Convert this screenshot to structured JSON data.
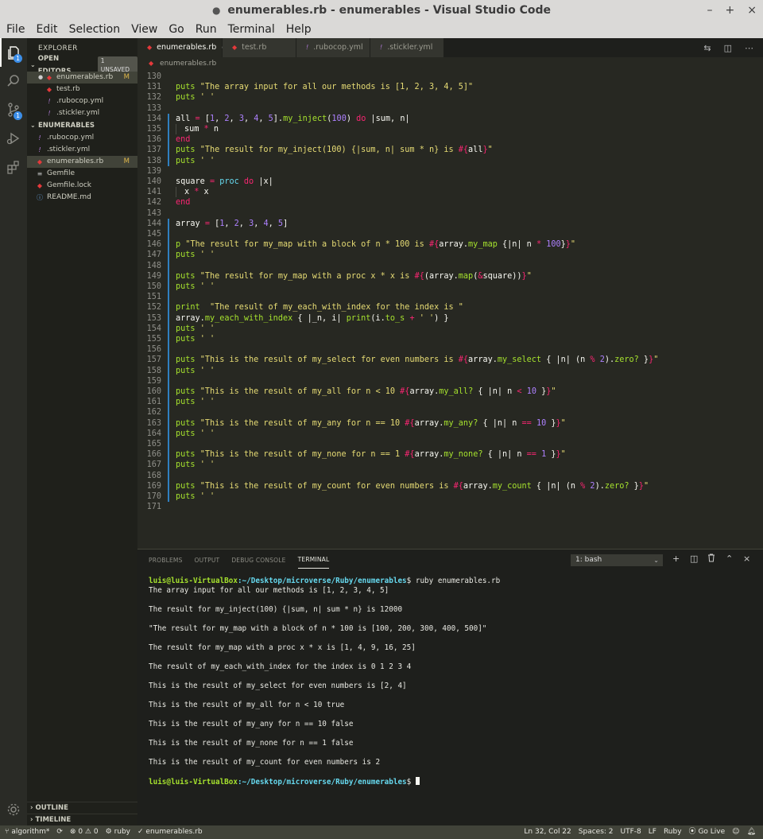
{
  "window": {
    "title": "enumerables.rb - enumerables - Visual Studio Code",
    "modified_dot": "●",
    "minimize": "–",
    "maximize": "+",
    "close": "×"
  },
  "menu": [
    "File",
    "Edit",
    "Selection",
    "View",
    "Go",
    "Run",
    "Terminal",
    "Help"
  ],
  "activity": {
    "explorer_badge": "1",
    "scm_badge": "1"
  },
  "sidebar": {
    "title": "EXPLORER",
    "open_editors_label": "OPEN EDITORS",
    "unsaved_badge": "1 UNSAVED",
    "open_editors": [
      {
        "name": "enumerables.rb",
        "icon": "ruby-icon",
        "flag": "M",
        "selected": true
      },
      {
        "name": "test.rb",
        "icon": "ruby-icon",
        "flag": ""
      },
      {
        "name": ".rubocop.yml",
        "icon": "yml-icon",
        "flag": ""
      },
      {
        "name": ".stickler.yml",
        "icon": "yml-icon",
        "flag": ""
      }
    ],
    "folder_label": "ENUMERABLES",
    "files": [
      {
        "name": ".rubocop.yml",
        "icon": "yml-icon",
        "flag": ""
      },
      {
        "name": ".stickler.yml",
        "icon": "yml-icon",
        "flag": ""
      },
      {
        "name": "enumerables.rb",
        "icon": "ruby-icon",
        "flag": "M",
        "selected": true
      },
      {
        "name": "Gemfile",
        "icon": "lines-icon",
        "flag": ""
      },
      {
        "name": "Gemfile.lock",
        "icon": "ruby-icon",
        "flag": ""
      },
      {
        "name": "README.md",
        "icon": "info-icon",
        "flag": ""
      }
    ],
    "outline_label": "OUTLINE",
    "timeline_label": "TIMELINE"
  },
  "tabs": [
    {
      "name": "enumerables.rb",
      "icon": "ruby-icon",
      "active": true,
      "dirty": true
    },
    {
      "name": "test.rb",
      "icon": "ruby-icon",
      "active": false
    },
    {
      "name": ".rubocop.yml",
      "icon": "yml-icon",
      "active": false
    },
    {
      "name": ".stickler.yml",
      "icon": "yml-icon",
      "active": false
    }
  ],
  "breadcrumb": "enumerables.rb",
  "editor": {
    "lines": [
      {
        "n": "130",
        "g": 0,
        "t": []
      },
      {
        "n": "131",
        "g": 0,
        "t": [
          [
            "fn",
            "puts"
          ],
          [
            "txt",
            " "
          ],
          [
            "str",
            "\"The array input for all our methods is [1, 2, 3, 4, 5]\""
          ]
        ]
      },
      {
        "n": "132",
        "g": 0,
        "t": [
          [
            "fn",
            "puts"
          ],
          [
            "txt",
            " "
          ],
          [
            "str",
            "' '"
          ]
        ]
      },
      {
        "n": "133",
        "g": 0,
        "t": []
      },
      {
        "n": "134",
        "g": 1,
        "t": [
          [
            "txt",
            "all "
          ],
          [
            "kw",
            "="
          ],
          [
            "txt",
            " ["
          ],
          [
            "num",
            "1"
          ],
          [
            "txt",
            ", "
          ],
          [
            "num",
            "2"
          ],
          [
            "txt",
            ", "
          ],
          [
            "num",
            "3"
          ],
          [
            "txt",
            ", "
          ],
          [
            "num",
            "4"
          ],
          [
            "txt",
            ", "
          ],
          [
            "num",
            "5"
          ],
          [
            "txt",
            "]."
          ],
          [
            "fn",
            "my_inject"
          ],
          [
            "txt",
            "("
          ],
          [
            "num",
            "100"
          ],
          [
            "txt",
            ") "
          ],
          [
            "kw",
            "do"
          ],
          [
            "txt",
            " |sum, n|"
          ]
        ]
      },
      {
        "n": "135",
        "g": 1,
        "i": 1,
        "t": [
          [
            "txt",
            "sum "
          ],
          [
            "kw",
            "*"
          ],
          [
            "txt",
            " n"
          ]
        ]
      },
      {
        "n": "136",
        "g": 1,
        "t": [
          [
            "kw",
            "end"
          ]
        ]
      },
      {
        "n": "137",
        "g": 1,
        "t": [
          [
            "fn",
            "puts"
          ],
          [
            "txt",
            " "
          ],
          [
            "str",
            "\"The result for my_inject(100) {|sum, n| sum * n} is "
          ],
          [
            "ip",
            "#{"
          ],
          [
            "txt",
            "all"
          ],
          [
            "ip",
            "}"
          ],
          [
            "str",
            "\""
          ]
        ]
      },
      {
        "n": "138",
        "g": 1,
        "t": [
          [
            "fn",
            "puts"
          ],
          [
            "txt",
            " "
          ],
          [
            "str",
            "' '"
          ]
        ]
      },
      {
        "n": "139",
        "g": 0,
        "t": []
      },
      {
        "n": "140",
        "g": 0,
        "t": [
          [
            "txt",
            "square "
          ],
          [
            "kw",
            "="
          ],
          [
            "txt",
            " "
          ],
          [
            "c",
            "proc"
          ],
          [
            "txt",
            " "
          ],
          [
            "kw",
            "do"
          ],
          [
            "txt",
            " |x|"
          ]
        ]
      },
      {
        "n": "141",
        "g": 0,
        "i": 1,
        "t": [
          [
            "txt",
            "x "
          ],
          [
            "kw",
            "*"
          ],
          [
            "txt",
            " x"
          ]
        ]
      },
      {
        "n": "142",
        "g": 0,
        "t": [
          [
            "kw",
            "end"
          ]
        ]
      },
      {
        "n": "143",
        "g": 0,
        "t": []
      },
      {
        "n": "144",
        "g": 1,
        "t": [
          [
            "txt",
            "array "
          ],
          [
            "kw",
            "="
          ],
          [
            "txt",
            " ["
          ],
          [
            "num",
            "1"
          ],
          [
            "txt",
            ", "
          ],
          [
            "num",
            "2"
          ],
          [
            "txt",
            ", "
          ],
          [
            "num",
            "3"
          ],
          [
            "txt",
            ", "
          ],
          [
            "num",
            "4"
          ],
          [
            "txt",
            ", "
          ],
          [
            "num",
            "5"
          ],
          [
            "txt",
            "]"
          ]
        ]
      },
      {
        "n": "145",
        "g": 1,
        "t": []
      },
      {
        "n": "146",
        "g": 1,
        "t": [
          [
            "fn",
            "p"
          ],
          [
            "txt",
            " "
          ],
          [
            "str",
            "\"The result for my_map with a block of n * 100 is "
          ],
          [
            "ip",
            "#{"
          ],
          [
            "txt",
            "array."
          ],
          [
            "fn",
            "my_map"
          ],
          [
            "txt",
            " {|n| n "
          ],
          [
            "kw",
            "*"
          ],
          [
            "txt",
            " "
          ],
          [
            "num",
            "100"
          ],
          [
            "txt",
            "}"
          ],
          [
            "ip",
            "}"
          ],
          [
            "str",
            "\""
          ]
        ]
      },
      {
        "n": "147",
        "g": 1,
        "t": [
          [
            "fn",
            "puts"
          ],
          [
            "txt",
            " "
          ],
          [
            "str",
            "' '"
          ]
        ]
      },
      {
        "n": "148",
        "g": 1,
        "t": []
      },
      {
        "n": "149",
        "g": 1,
        "t": [
          [
            "fn",
            "puts"
          ],
          [
            "txt",
            " "
          ],
          [
            "str",
            "\"The result for my_map with a proc x * x is "
          ],
          [
            "ip",
            "#{"
          ],
          [
            "txt",
            "(array."
          ],
          [
            "fn",
            "map"
          ],
          [
            "txt",
            "("
          ],
          [
            "kw",
            "&"
          ],
          [
            "txt",
            "square))"
          ],
          [
            "ip",
            "}"
          ],
          [
            "str",
            "\""
          ]
        ]
      },
      {
        "n": "150",
        "g": 1,
        "t": [
          [
            "fn",
            "puts"
          ],
          [
            "txt",
            " "
          ],
          [
            "str",
            "' '"
          ]
        ]
      },
      {
        "n": "151",
        "g": 1,
        "t": []
      },
      {
        "n": "152",
        "g": 1,
        "t": [
          [
            "fn",
            "print"
          ],
          [
            "txt",
            "  "
          ],
          [
            "str",
            "\"The result of my_each_with_index for the index is \""
          ]
        ]
      },
      {
        "n": "153",
        "g": 1,
        "t": [
          [
            "txt",
            "array."
          ],
          [
            "fn",
            "my_each_with_index"
          ],
          [
            "txt",
            " { |_n, i| "
          ],
          [
            "fn",
            "print"
          ],
          [
            "txt",
            "(i."
          ],
          [
            "fn",
            "to_s"
          ],
          [
            "txt",
            " "
          ],
          [
            "kw",
            "+"
          ],
          [
            "txt",
            " "
          ],
          [
            "str",
            "' '"
          ],
          [
            "txt",
            ") }"
          ]
        ]
      },
      {
        "n": "154",
        "g": 1,
        "t": [
          [
            "fn",
            "puts"
          ],
          [
            "txt",
            " "
          ],
          [
            "str",
            "' '"
          ]
        ]
      },
      {
        "n": "155",
        "g": 1,
        "t": [
          [
            "fn",
            "puts"
          ],
          [
            "txt",
            " "
          ],
          [
            "str",
            "' '"
          ]
        ]
      },
      {
        "n": "156",
        "g": 1,
        "t": []
      },
      {
        "n": "157",
        "g": 1,
        "t": [
          [
            "fn",
            "puts"
          ],
          [
            "txt",
            " "
          ],
          [
            "str",
            "\"This is the result of my_select for even numbers is "
          ],
          [
            "ip",
            "#{"
          ],
          [
            "txt",
            "array."
          ],
          [
            "fn",
            "my_select"
          ],
          [
            "txt",
            " { |n| (n "
          ],
          [
            "kw",
            "%"
          ],
          [
            "txt",
            " "
          ],
          [
            "num",
            "2"
          ],
          [
            "txt",
            ")."
          ],
          [
            "fn",
            "zero?"
          ],
          [
            "txt",
            " }"
          ],
          [
            "ip",
            "}"
          ],
          [
            "str",
            "\""
          ]
        ]
      },
      {
        "n": "158",
        "g": 1,
        "t": [
          [
            "fn",
            "puts"
          ],
          [
            "txt",
            " "
          ],
          [
            "str",
            "' '"
          ]
        ]
      },
      {
        "n": "159",
        "g": 1,
        "t": []
      },
      {
        "n": "160",
        "g": 1,
        "t": [
          [
            "fn",
            "puts"
          ],
          [
            "txt",
            " "
          ],
          [
            "str",
            "\"This is the result of my_all for n < 10 "
          ],
          [
            "ip",
            "#{"
          ],
          [
            "txt",
            "array."
          ],
          [
            "fn",
            "my_all?"
          ],
          [
            "txt",
            " { |n| n "
          ],
          [
            "kw",
            "<"
          ],
          [
            "txt",
            " "
          ],
          [
            "num",
            "10"
          ],
          [
            "txt",
            " }"
          ],
          [
            "ip",
            "}"
          ],
          [
            "str",
            "\""
          ]
        ]
      },
      {
        "n": "161",
        "g": 1,
        "t": [
          [
            "fn",
            "puts"
          ],
          [
            "txt",
            " "
          ],
          [
            "str",
            "' '"
          ]
        ]
      },
      {
        "n": "162",
        "g": 1,
        "t": []
      },
      {
        "n": "163",
        "g": 1,
        "t": [
          [
            "fn",
            "puts"
          ],
          [
            "txt",
            " "
          ],
          [
            "str",
            "\"This is the result of my_any for n == 10 "
          ],
          [
            "ip",
            "#{"
          ],
          [
            "txt",
            "array."
          ],
          [
            "fn",
            "my_any?"
          ],
          [
            "txt",
            " { |n| n "
          ],
          [
            "kw",
            "=="
          ],
          [
            "txt",
            " "
          ],
          [
            "num",
            "10"
          ],
          [
            "txt",
            " }"
          ],
          [
            "ip",
            "}"
          ],
          [
            "str",
            "\""
          ]
        ]
      },
      {
        "n": "164",
        "g": 1,
        "t": [
          [
            "fn",
            "puts"
          ],
          [
            "txt",
            " "
          ],
          [
            "str",
            "' '"
          ]
        ]
      },
      {
        "n": "165",
        "g": 1,
        "t": []
      },
      {
        "n": "166",
        "g": 1,
        "t": [
          [
            "fn",
            "puts"
          ],
          [
            "txt",
            " "
          ],
          [
            "str",
            "\"This is the result of my_none for n == 1 "
          ],
          [
            "ip",
            "#{"
          ],
          [
            "txt",
            "array."
          ],
          [
            "fn",
            "my_none?"
          ],
          [
            "txt",
            " { |n| n "
          ],
          [
            "kw",
            "=="
          ],
          [
            "txt",
            " "
          ],
          [
            "num",
            "1"
          ],
          [
            "txt",
            " }"
          ],
          [
            "ip",
            "}"
          ],
          [
            "str",
            "\""
          ]
        ]
      },
      {
        "n": "167",
        "g": 1,
        "t": [
          [
            "fn",
            "puts"
          ],
          [
            "txt",
            " "
          ],
          [
            "str",
            "' '"
          ]
        ]
      },
      {
        "n": "168",
        "g": 1,
        "t": []
      },
      {
        "n": "169",
        "g": 1,
        "t": [
          [
            "fn",
            "puts"
          ],
          [
            "txt",
            " "
          ],
          [
            "str",
            "\"This is the result of my_count for even numbers is "
          ],
          [
            "ip",
            "#{"
          ],
          [
            "txt",
            "array."
          ],
          [
            "fn",
            "my_count"
          ],
          [
            "txt",
            " { |n| (n "
          ],
          [
            "kw",
            "%"
          ],
          [
            "txt",
            " "
          ],
          [
            "num",
            "2"
          ],
          [
            "txt",
            ")."
          ],
          [
            "fn",
            "zero?"
          ],
          [
            "txt",
            " }"
          ],
          [
            "ip",
            "}"
          ],
          [
            "str",
            "\""
          ]
        ]
      },
      {
        "n": "170",
        "g": 1,
        "t": [
          [
            "fn",
            "puts"
          ],
          [
            "txt",
            " "
          ],
          [
            "str",
            "' '"
          ]
        ]
      },
      {
        "n": "171",
        "g": 0,
        "t": []
      }
    ]
  },
  "panel": {
    "tabs": [
      "PROBLEMS",
      "OUTPUT",
      "DEBUG CONSOLE",
      "TERMINAL"
    ],
    "active_tab": "TERMINAL",
    "terminal_select": "1: bash",
    "add_icon": "+",
    "split_icon": "◫",
    "trash_icon": "🗑",
    "maximize_icon": "︿",
    "close_icon": "×",
    "prompt_user": "luis@luis-VirtualBox",
    "prompt_path": ":~/Desktop/microverse/Ruby/enumerables",
    "prompt_end": "$ ",
    "command": "ruby enumerables.rb",
    "output": [
      "The array input for all our methods is [1, 2, 3, 4, 5]",
      "",
      "The result for my_inject(100) {|sum, n| sum * n} is 12000",
      "",
      "\"The result for my_map with a block of n * 100 is [100, 200, 300, 400, 500]\"",
      "",
      "The result for my_map with a proc x * x is [1, 4, 9, 16, 25]",
      "",
      "The result of my_each_with_index for the index is 0 1 2 3 4",
      "",
      "This is the result of my_select for even numbers is [2, 4]",
      "",
      "This is the result of my_all for n < 10 true",
      "",
      "This is the result of my_any for n == 10 false",
      "",
      "This is the result of my_none for n == 1 false",
      "",
      "This is the result of my_count for even numbers is 2",
      ""
    ]
  },
  "status": {
    "branch": "algorithm*",
    "sync": "⟳",
    "errors": "0",
    "warnings": "0",
    "ruby": "ruby",
    "file": "✓ enumerables.rb",
    "position": "Ln 32, Col 22",
    "spaces": "Spaces: 2",
    "encoding": "UTF-8",
    "eol": "LF",
    "language": "Ruby",
    "golive": "Go Live"
  }
}
